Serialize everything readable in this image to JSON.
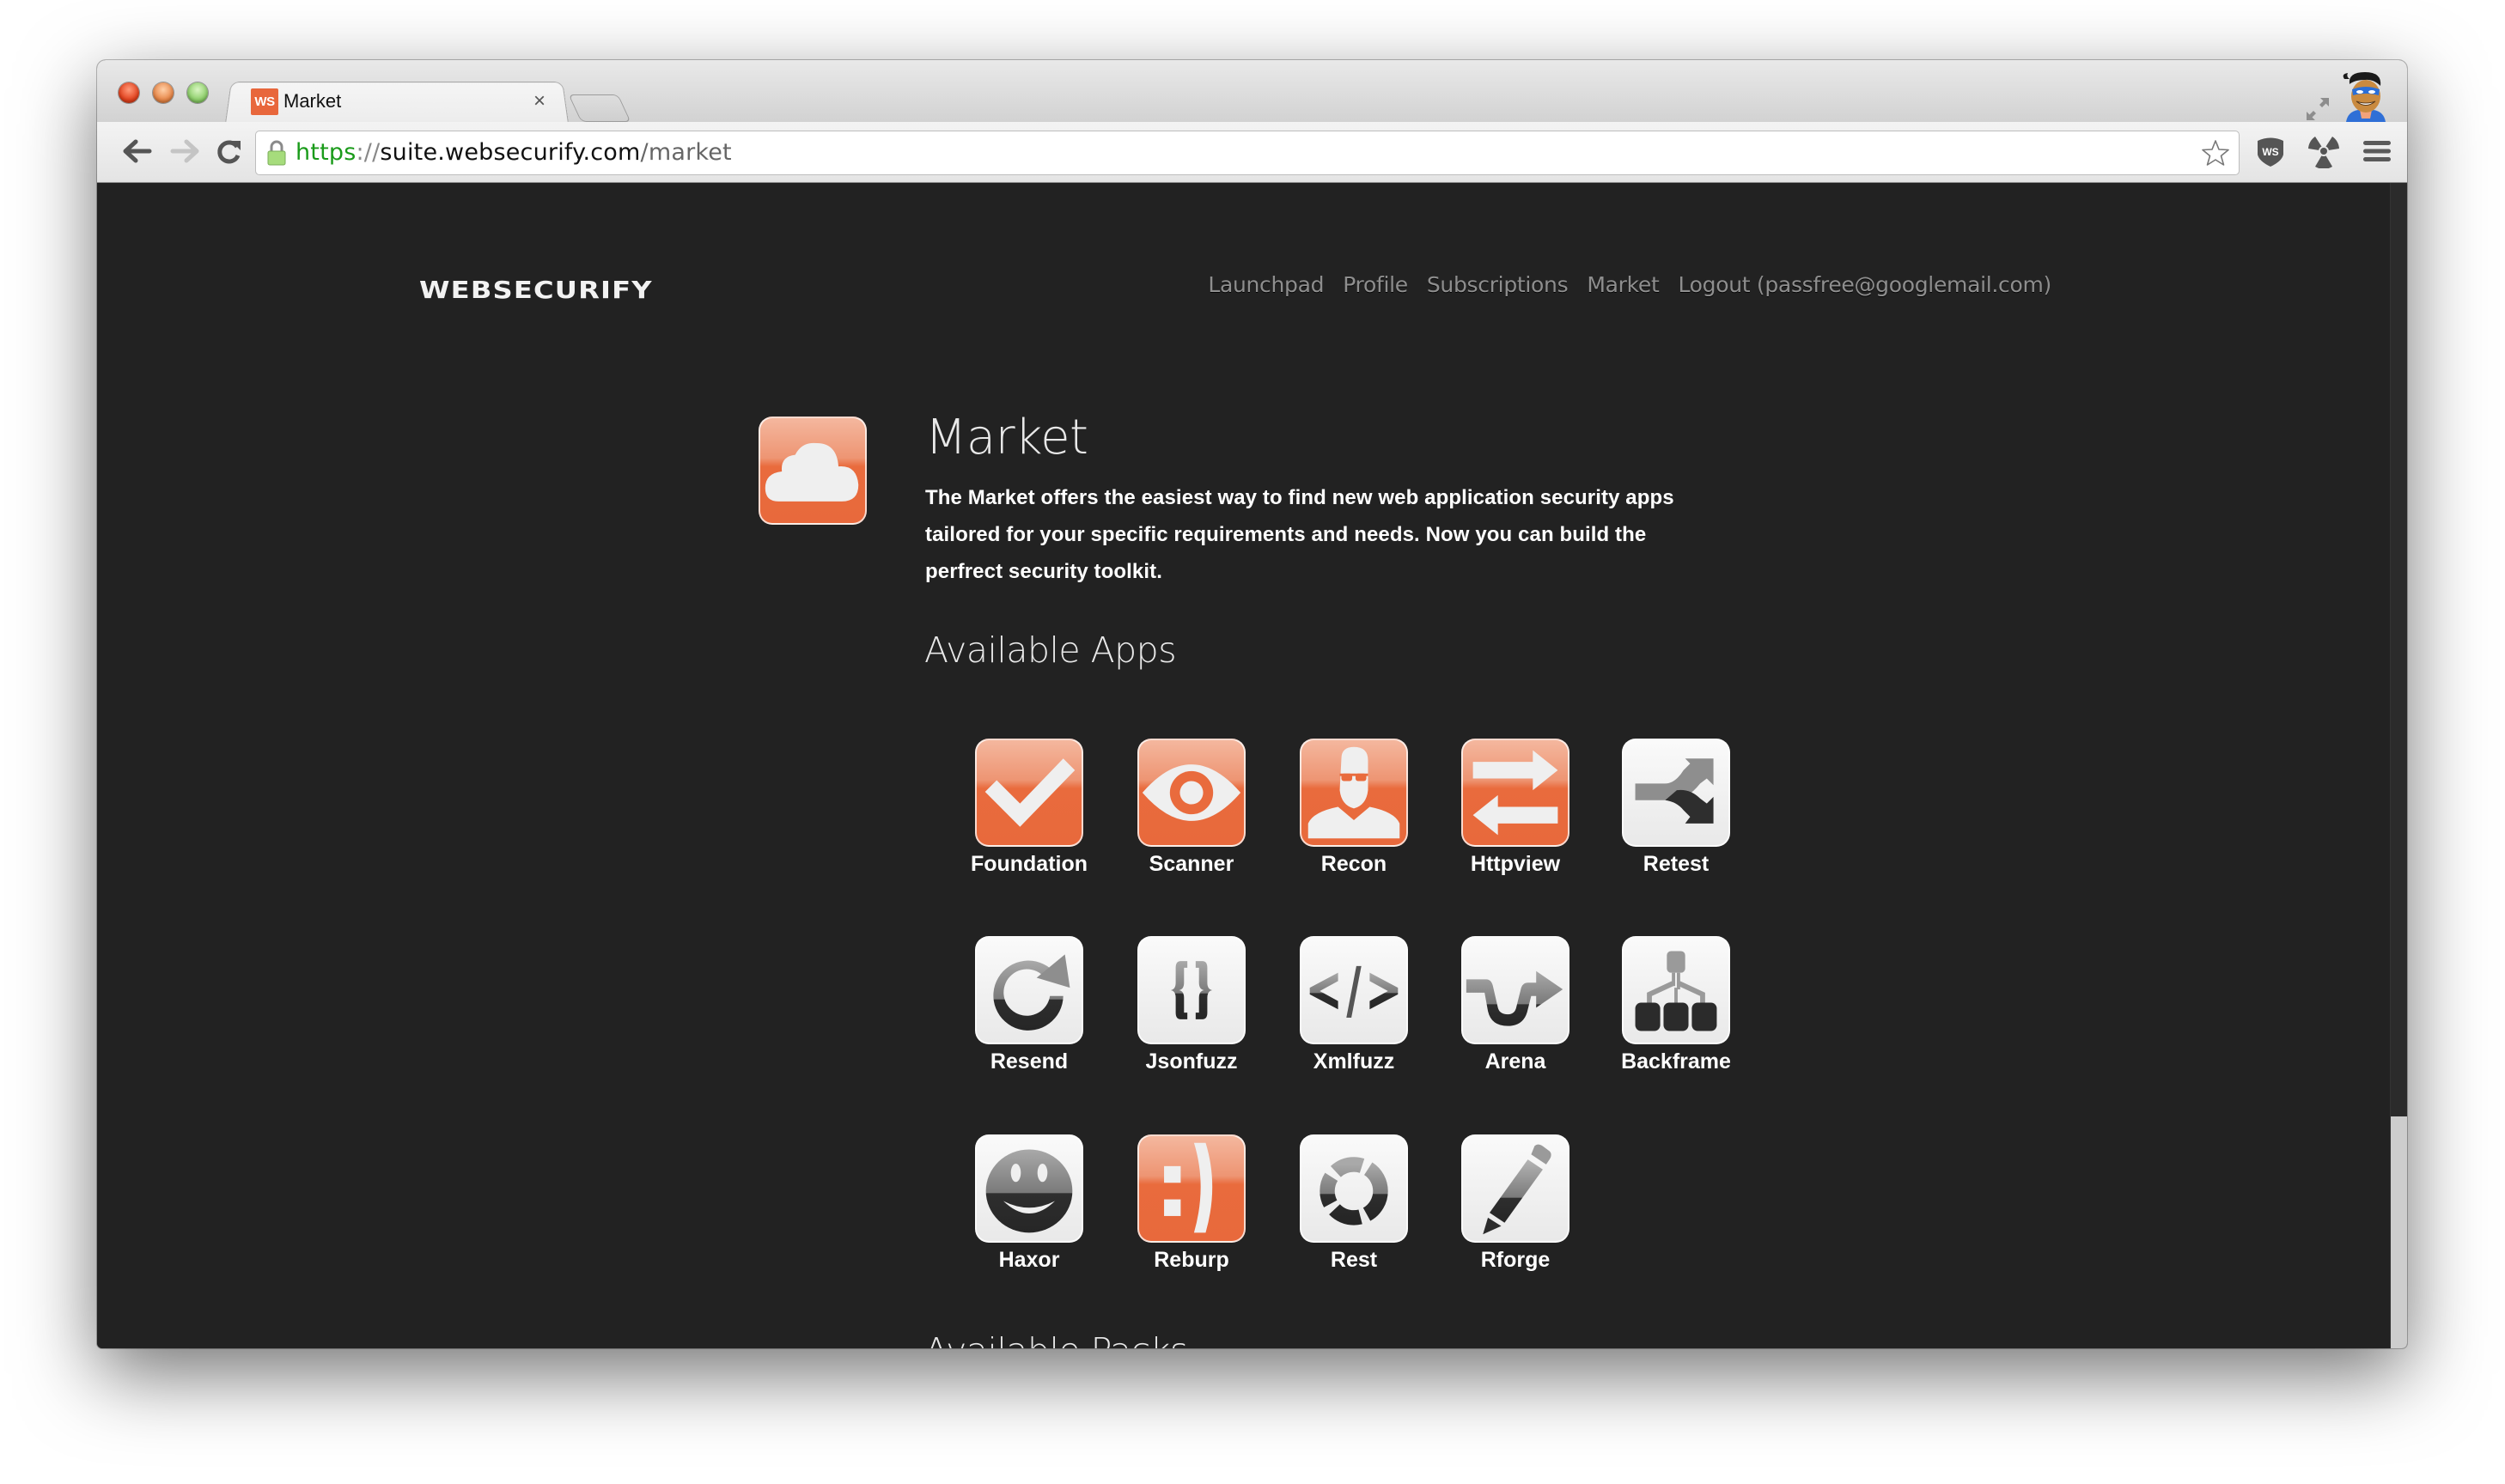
{
  "browser": {
    "tab": {
      "favicon_text": "WS",
      "title": "Market",
      "close_icon": "×"
    },
    "url": {
      "scheme": "https",
      "separator": "://",
      "host": "suite.websecurify.com",
      "path": "/market"
    },
    "icons": [
      "back-icon",
      "forward-icon",
      "reload-icon",
      "lock-icon",
      "bookmark-star-icon",
      "websecurify-extension-icon",
      "radiation-extension-icon",
      "menu-icon",
      "fullscreen-icon",
      "profile-avatar-icon"
    ]
  },
  "header": {
    "logo": "WEBSECURIFY",
    "nav": [
      {
        "label": "Launchpad"
      },
      {
        "label": "Profile"
      },
      {
        "label": "Subscriptions"
      },
      {
        "label": "Market"
      },
      {
        "label": "Logout (passfree@googlemail.com)"
      }
    ]
  },
  "market": {
    "icon": "cloud-icon",
    "title": "Market",
    "description": "The Market offers the easiest way to find new web application security apps tailored for your specific requirements and needs. Now you can build the perfrect security toolkit."
  },
  "available_apps": {
    "title": "Available Apps",
    "apps": [
      {
        "name": "Foundation",
        "icon": "checkmark-icon",
        "style": "orange"
      },
      {
        "name": "Scanner",
        "icon": "eye-icon",
        "style": "orange"
      },
      {
        "name": "Recon",
        "icon": "person-icon",
        "style": "orange"
      },
      {
        "name": "Httpview",
        "icon": "swap-arrows-icon",
        "style": "orange"
      },
      {
        "name": "Retest",
        "icon": "split-arrows-icon",
        "style": "white"
      },
      {
        "name": "Resend",
        "icon": "redo-arrow-icon",
        "style": "white"
      },
      {
        "name": "Jsonfuzz",
        "icon": "curly-braces-icon",
        "style": "white"
      },
      {
        "name": "Xmlfuzz",
        "icon": "code-tag-icon",
        "style": "white"
      },
      {
        "name": "Arena",
        "icon": "path-arrow-icon",
        "style": "white"
      },
      {
        "name": "Backframe",
        "icon": "hierarchy-icon",
        "style": "white"
      },
      {
        "name": "Haxor",
        "icon": "smiley-icon",
        "style": "white"
      },
      {
        "name": "Reburp",
        "icon": "emoticon-icon",
        "style": "orange"
      },
      {
        "name": "Rest",
        "icon": "ring-segments-icon",
        "style": "white"
      },
      {
        "name": "Rforge",
        "icon": "pencil-icon",
        "style": "white"
      }
    ]
  },
  "available_packs": {
    "title": "Available Packs"
  }
}
